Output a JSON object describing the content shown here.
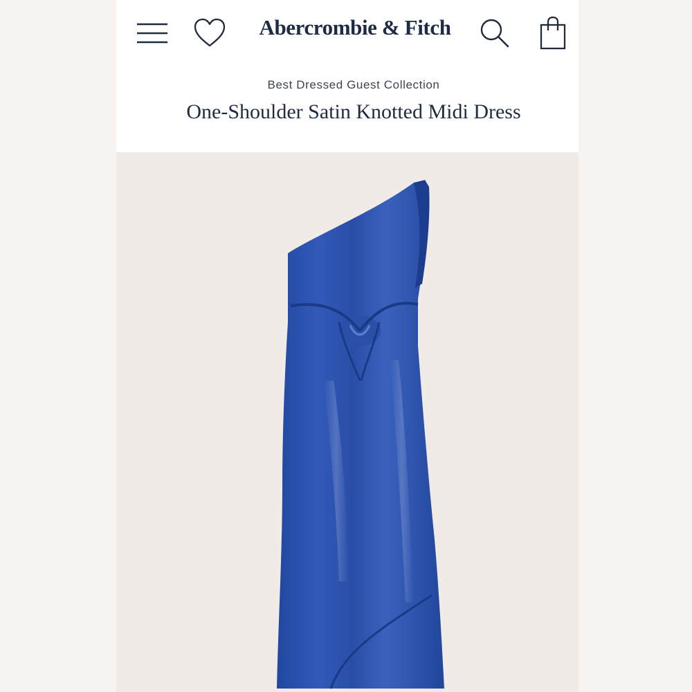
{
  "header": {
    "brand": "Abercrombie & Fitch",
    "icons": {
      "menu": "hamburger-menu-icon",
      "wishlist": "heart-icon",
      "search": "search-icon",
      "bag": "shopping-bag-icon"
    }
  },
  "product": {
    "collection": "Best Dressed Guest Collection",
    "title": "One-Shoulder Satin Knotted Midi Dress",
    "color": "#2a4ea5"
  },
  "colors": {
    "brand_text": "#1d2b45",
    "background": "#f1ebe6",
    "header_background": "#ffffff"
  }
}
